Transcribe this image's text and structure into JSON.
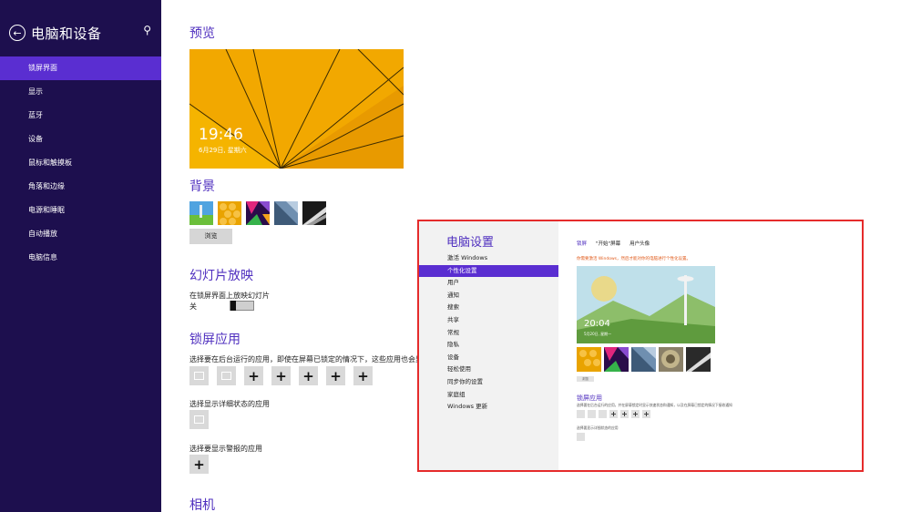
{
  "sidebar": {
    "title": "电脑和设备",
    "back_icon": "back-arrow-icon",
    "search_icon": "search-icon",
    "items": [
      {
        "label": "锁屏界面",
        "active": true
      },
      {
        "label": "显示",
        "active": false
      },
      {
        "label": "蓝牙",
        "active": false
      },
      {
        "label": "设备",
        "active": false
      },
      {
        "label": "鼠标和触摸板",
        "active": false
      },
      {
        "label": "角落和边缘",
        "active": false
      },
      {
        "label": "电源和睡眠",
        "active": false
      },
      {
        "label": "自动播放",
        "active": false
      },
      {
        "label": "电脑信息",
        "active": false
      }
    ]
  },
  "main": {
    "preview_title": "预览",
    "preview_time": "19:46",
    "preview_date": "6月29日, 星期六",
    "background_title": "背景",
    "browse_label": "浏览",
    "slideshow_title": "幻灯片放映",
    "slideshow_label": "在锁屏界面上放映幻灯片",
    "slideshow_state": "关",
    "lockapps_title": "锁屏应用",
    "lockapps_desc": "选择要在后台运行的应用，即使在屏幕已锁定的情况下，这些应用也会显示",
    "detailed_status_label": "选择显示详细状态的应用",
    "alarm_label": "选择要显示警报的应用",
    "camera_title": "相机",
    "app_slot_add_count": 5
  },
  "overlay": {
    "title": "电脑设置",
    "items": [
      {
        "label": "激活 Windows",
        "active": false
      },
      {
        "label": "个性化设置",
        "active": true
      },
      {
        "label": "用户",
        "active": false
      },
      {
        "label": "通知",
        "active": false
      },
      {
        "label": "搜索",
        "active": false
      },
      {
        "label": "共享",
        "active": false
      },
      {
        "label": "常规",
        "active": false
      },
      {
        "label": "隐私",
        "active": false
      },
      {
        "label": "设备",
        "active": false
      },
      {
        "label": "轻松使用",
        "active": false
      },
      {
        "label": "同步你的设置",
        "active": false
      },
      {
        "label": "家庭组",
        "active": false
      },
      {
        "label": "Windows 更新",
        "active": false
      }
    ],
    "tabs": [
      "锁屏",
      "\"开始\"屏幕",
      "用户头像"
    ],
    "note": "你需要激活 Windows，然后才能对你的电脑进行个性化设置。",
    "preview_time": "20:04",
    "preview_date": "5月20日, 星期一",
    "browse_label": "浏览",
    "lockapps_title": "锁屏应用",
    "lockapps_desc": "选择要在后台运行的应用，并在屏幕锁定时显示快速状态和通知，以及在屏幕已锁定的情况下接收通知",
    "detailed_status_label": "选择要显示详细状态的应用"
  },
  "colors": {
    "sidebar_bg": "#1d0f4e",
    "accent": "#5a2ed1",
    "title_purple": "#4f2fbf",
    "highlight_border": "#e52b2b",
    "preview_orange": "#f0a500"
  }
}
